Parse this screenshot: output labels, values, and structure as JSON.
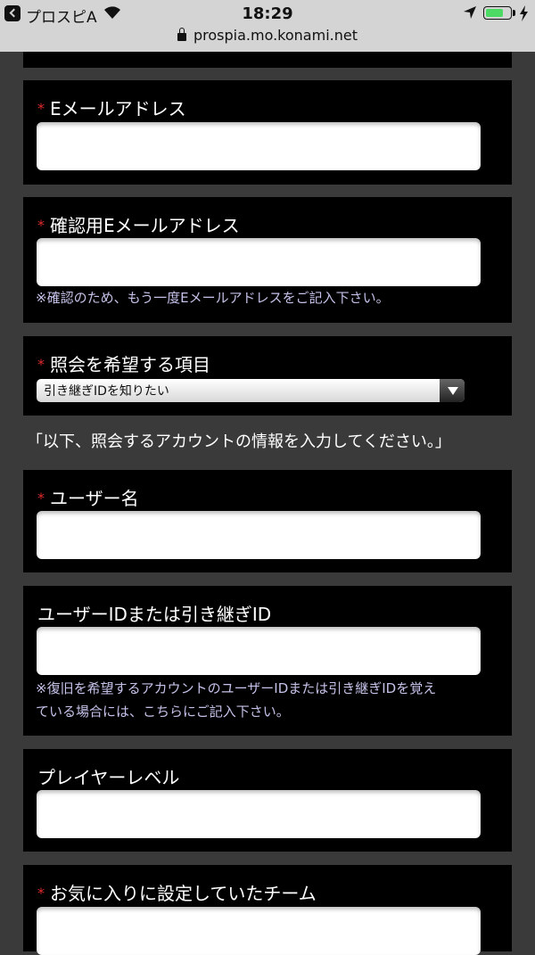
{
  "status_bar": {
    "back_app": "プロスピA",
    "time": "18:29",
    "url": "prospia.mo.konami.net"
  },
  "required_mark": "*",
  "form": {
    "email": {
      "label": "Eメールアドレス",
      "value": ""
    },
    "email_confirm": {
      "label": "確認用Eメールアドレス",
      "value": "",
      "note": "※確認のため、もう一度Eメールアドレスをご記入下さい。"
    },
    "inquiry_item": {
      "label": "照会を希望する項目",
      "selected": "引き継ぎIDを知りたい"
    },
    "instruction": "「以下、照会するアカウントの情報を入力してください。」",
    "user_name": {
      "label": "ユーザー名",
      "value": ""
    },
    "user_id": {
      "label": "ユーザーIDまたは引き継ぎID",
      "value": "",
      "note_line1": "※復旧を希望するアカウントのユーザーIDまたは引き継ぎIDを覚え",
      "note_line2": "ている場合には、こちらにご記入下さい。"
    },
    "player_level": {
      "label": "プレイヤーレベル",
      "value": ""
    },
    "favorite_team": {
      "label": "お気に入りに設定していたチーム",
      "value": ""
    }
  }
}
